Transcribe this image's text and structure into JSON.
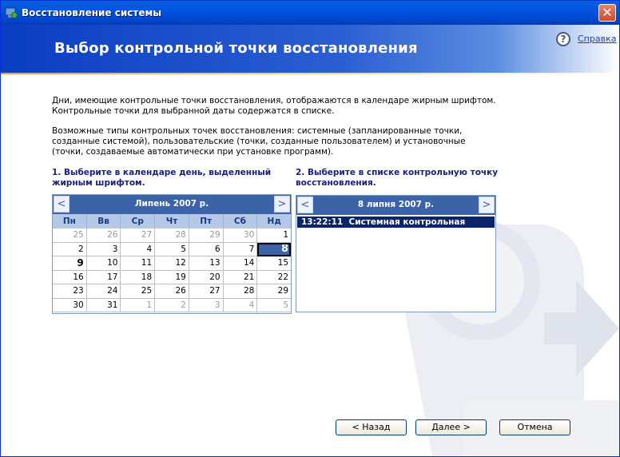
{
  "window": {
    "title": "Восстановление системы",
    "close_glyph": "✕"
  },
  "header": {
    "title": "Выбор контрольной точки восстановления",
    "help_label": "Справка",
    "help_glyph": "?"
  },
  "intro": {
    "line1": "Дни, имеющие контрольные точки восстановления, отображаются в календаре жирным шрифтом. Контрольные точки для выбранной даты содержатся в списке.",
    "line2": "Возможные типы контрольных точек восстановления: системные (запланированные точки, созданные системой), пользовательские (точки, созданные пользователем) и установочные (точки, создаваемые автоматически при установке программ)."
  },
  "steps": {
    "step1": "1. Выберите в календаре день, выделенный жирным шрифтом.",
    "step2": "2. Выберите в списке контрольную точку восстановления."
  },
  "calendar": {
    "month_label": "Липень 2007 р.",
    "prev": "<",
    "next": ">",
    "weekdays": [
      "Пн",
      "Вв",
      "Ср",
      "Чт",
      "Пт",
      "Сб",
      "Нд"
    ],
    "weeks": [
      [
        {
          "d": "25",
          "o": true
        },
        {
          "d": "26",
          "o": true
        },
        {
          "d": "27",
          "o": true
        },
        {
          "d": "28",
          "o": true
        },
        {
          "d": "29",
          "o": true
        },
        {
          "d": "30",
          "o": true
        },
        {
          "d": "1"
        }
      ],
      [
        {
          "d": "2"
        },
        {
          "d": "3"
        },
        {
          "d": "4"
        },
        {
          "d": "5"
        },
        {
          "d": "6"
        },
        {
          "d": "7"
        },
        {
          "d": "8",
          "sel": true
        }
      ],
      [
        {
          "d": "9",
          "b": true
        },
        {
          "d": "10"
        },
        {
          "d": "11"
        },
        {
          "d": "12"
        },
        {
          "d": "13"
        },
        {
          "d": "14"
        },
        {
          "d": "15"
        }
      ],
      [
        {
          "d": "16"
        },
        {
          "d": "17"
        },
        {
          "d": "18"
        },
        {
          "d": "19"
        },
        {
          "d": "20"
        },
        {
          "d": "21"
        },
        {
          "d": "22"
        }
      ],
      [
        {
          "d": "23"
        },
        {
          "d": "24"
        },
        {
          "d": "25"
        },
        {
          "d": "26"
        },
        {
          "d": "27"
        },
        {
          "d": "28"
        },
        {
          "d": "29"
        }
      ],
      [
        {
          "d": "30"
        },
        {
          "d": "31"
        },
        {
          "d": "1",
          "o": true
        },
        {
          "d": "2",
          "o": true
        },
        {
          "d": "3",
          "o": true
        },
        {
          "d": "4",
          "o": true
        },
        {
          "d": "5",
          "o": true
        }
      ]
    ]
  },
  "restore_list": {
    "date_label": "8 липня 2007 р.",
    "prev": "<",
    "next": ">",
    "items": [
      {
        "time": "13:22:11",
        "label": "Системная контрольная точка"
      }
    ]
  },
  "buttons": {
    "back": "< Назад",
    "next": "Далее >",
    "cancel": "Отмена"
  },
  "colors": {
    "accent": "#0054e3",
    "header_blue": "#2b5ed2",
    "selection": "#0a246a",
    "calendar_header": "#3a63a8"
  }
}
